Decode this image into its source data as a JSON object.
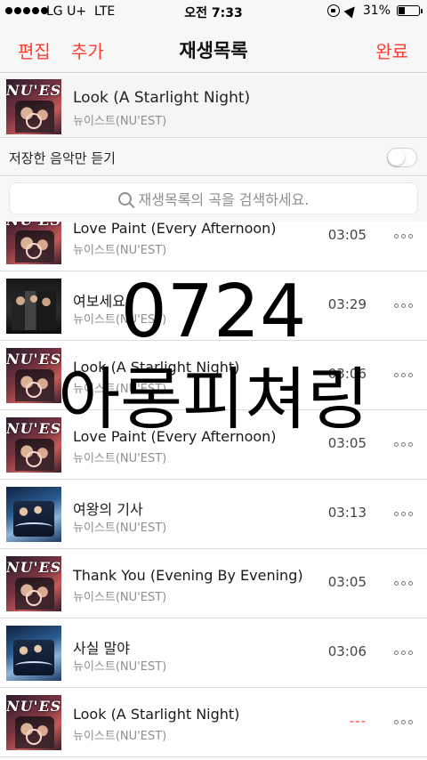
{
  "status_bar": {
    "carrier": "LG U+",
    "network": "LTE",
    "time": "오전 7:33",
    "battery": "31%",
    "battery_level": 0.31
  },
  "nav": {
    "edit": "편집",
    "add": "추가",
    "title": "재생목록",
    "done": "완료"
  },
  "now_playing": {
    "title": "Look (A Starlight Night)",
    "artist": "뉴이스트(NU'EST)"
  },
  "filter": {
    "label": "저장한 음악만 듣기",
    "enabled": false
  },
  "search": {
    "placeholder": "재생목록의 곡을 검색하세요."
  },
  "songs": [
    {
      "title": "Love Paint (Every Afternoon)",
      "artist": "뉴이스트(NU'EST)",
      "duration": "03:05",
      "art": "nuest"
    },
    {
      "title": "여보세요",
      "artist": "뉴이스트(NU'EST)",
      "duration": "03:29",
      "art": "dark"
    },
    {
      "title": "Look (A Starlight Night)",
      "artist": "뉴이스트(NU'EST)",
      "duration": "03:06",
      "art": "nuest"
    },
    {
      "title": "Love Paint (Every Afternoon)",
      "artist": "뉴이스트(NU'EST)",
      "duration": "03:05",
      "art": "nuest"
    },
    {
      "title": "여왕의 기사",
      "artist": "뉴이스트(NU'EST)",
      "duration": "03:13",
      "art": "blue"
    },
    {
      "title": "Thank You (Evening By Evening)",
      "artist": "뉴이스트(NU'EST)",
      "duration": "03:05",
      "art": "nuest"
    },
    {
      "title": "사실 말야",
      "artist": "뉴이스트(NU'EST)",
      "duration": "03:06",
      "art": "blue"
    },
    {
      "title": "Look (A Starlight Night)",
      "artist": "뉴이스트(NU'EST)",
      "duration": "---",
      "art": "nuest"
    }
  ],
  "art_logo": "NU'EST",
  "overlay": {
    "line1": "0724",
    "line2": "아롱피쳐링"
  },
  "colors": {
    "accent": "#ff3b30",
    "secondary_text": "#8e8e93"
  }
}
